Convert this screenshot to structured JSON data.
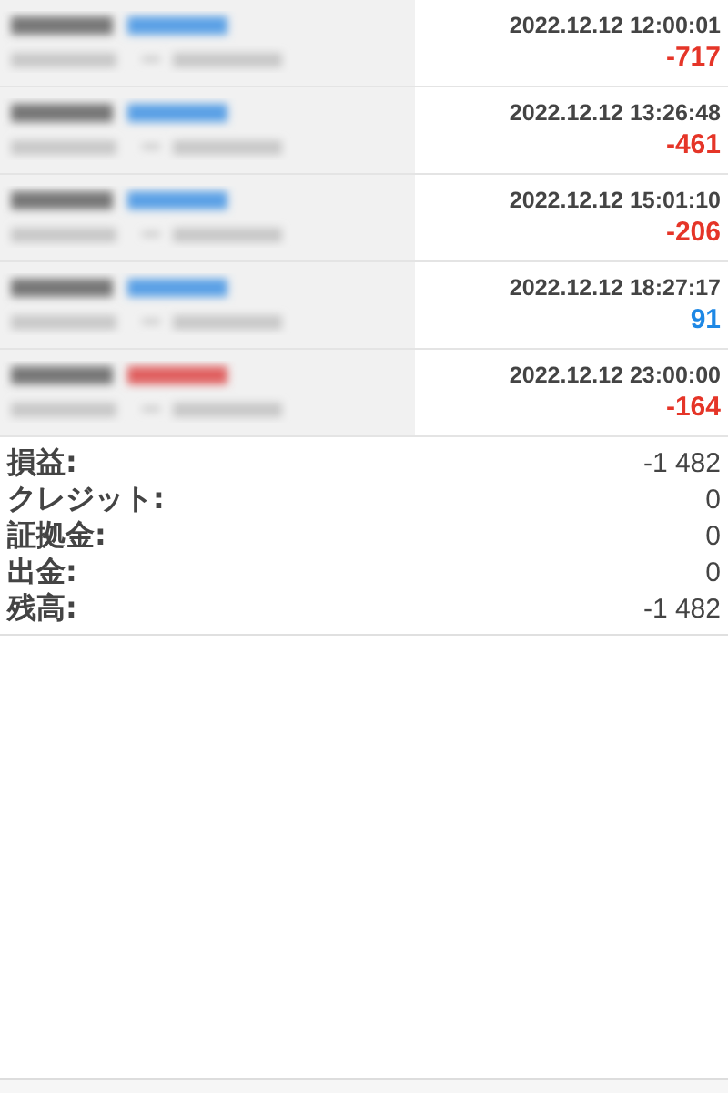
{
  "trades": [
    {
      "time": "2022.12.12 12:00:01",
      "profit": "-717",
      "kind": "loss",
      "color": "#5aa0e6"
    },
    {
      "time": "2022.12.12 13:26:48",
      "profit": "-461",
      "kind": "loss",
      "color": "#5aa0e6"
    },
    {
      "time": "2022.12.12 15:01:10",
      "profit": "-206",
      "kind": "loss",
      "color": "#5aa0e6"
    },
    {
      "time": "2022.12.12 18:27:17",
      "profit": "91",
      "kind": "profit",
      "color": "#5aa0e6"
    },
    {
      "time": "2022.12.12 23:00:00",
      "profit": "-164",
      "kind": "loss",
      "color": "#e06060"
    }
  ],
  "summary": [
    {
      "label": "損益:",
      "value": "-1 482"
    },
    {
      "label": "クレジット:",
      "value": "0"
    },
    {
      "label": "証拠金:",
      "value": "0"
    },
    {
      "label": "出金:",
      "value": "0"
    },
    {
      "label": "残高:",
      "value": "-1 482"
    }
  ]
}
